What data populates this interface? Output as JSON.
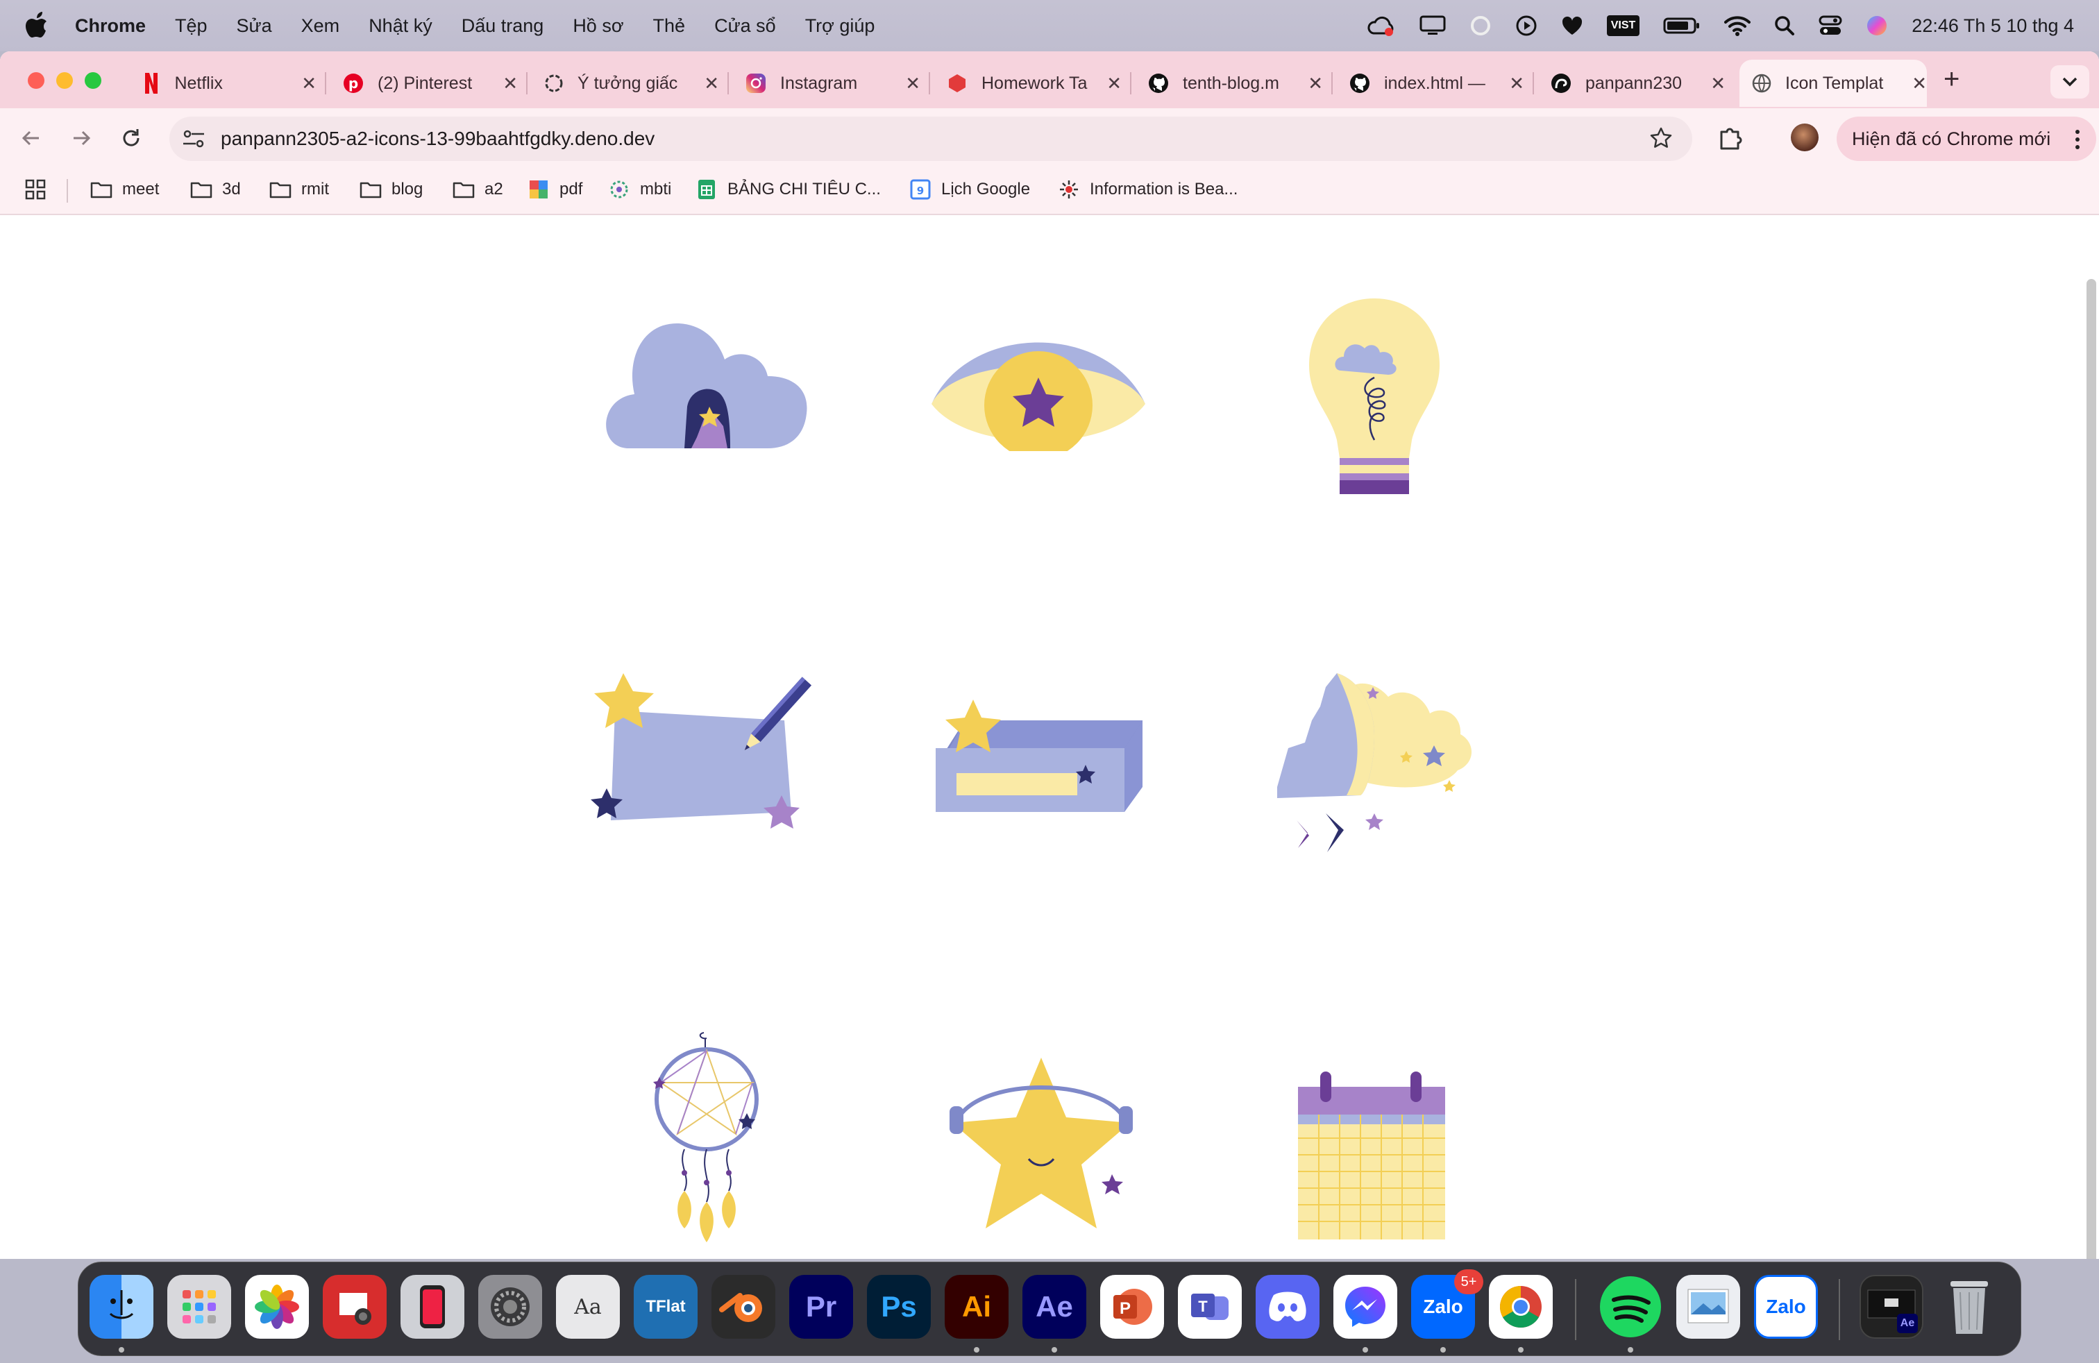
{
  "menubar": {
    "app_name": "Chrome",
    "items": [
      "Tệp",
      "Sửa",
      "Xem",
      "Nhật ký",
      "Dấu trang",
      "Hồ sơ",
      "Thẻ",
      "Cửa sổ",
      "Trợ giúp"
    ],
    "clock": "22:46 Th 5 10 thg 4",
    "vist_badge": "VIST"
  },
  "tabs": [
    {
      "title": "Netflix",
      "icon": "netflix-icon"
    },
    {
      "title": "(2) Pinterest",
      "icon": "pinterest-icon"
    },
    {
      "title": "Ý tưởng giấc",
      "icon": "chatgpt-icon"
    },
    {
      "title": "Instagram",
      "icon": "instagram-icon"
    },
    {
      "title": "Homework Ta",
      "icon": "homework-icon"
    },
    {
      "title": "tenth-blog.m",
      "icon": "github-icon"
    },
    {
      "title": "index.html —",
      "icon": "github-icon"
    },
    {
      "title": "panpann230",
      "icon": "deno-icon"
    },
    {
      "title": "Icon Templat",
      "icon": "globe-icon",
      "active": true
    }
  ],
  "address_bar": {
    "url": "panpann2305-a2-icons-13-99baahtfgdky.deno.dev"
  },
  "update_button": {
    "label": "Hiện đã có Chrome mới"
  },
  "bookmarks": [
    "meet",
    "3d",
    "rmit",
    "blog",
    "a2",
    "pdf",
    "mbti",
    "BẢNG CHI TIÊU C...",
    "Lịch Google",
    "Information is Bea..."
  ],
  "icons": [
    "cloud-star-icon",
    "eye-star-icon",
    "lightbulb-cloud-icon",
    "notepad-pencil-icon",
    "pencil-box-icon",
    "head-dream-icon",
    "dreamcatcher-icon",
    "headphone-star-icon",
    "calendar-icon"
  ],
  "dock": {
    "apps": [
      "Finder",
      "Launchpad",
      "Photos",
      "Photo Booth",
      "iPhone Mirroring",
      "System Settings",
      "Font Book",
      "TFlat Dictionary",
      "Blender",
      "Premiere Pro",
      "Photoshop",
      "Illustrator",
      "After Effects",
      "PowerPoint",
      "Teams",
      "Discord",
      "Messenger",
      "Zalo",
      "Chrome",
      "Spotify",
      "Preview",
      "Zalo",
      "Screen",
      "Trash"
    ],
    "zalo_badge": "5+",
    "pr_label": "Pr",
    "ps_label": "Ps",
    "ai_label": "Ai",
    "ae_label": "Ae",
    "zalo_label": "Zalo",
    "tflat_label": "TFlat"
  },
  "colors": {
    "lavender": "#a9b2df",
    "navy": "#2d2f6b",
    "yellow": "#f3cf55",
    "pale_yellow": "#faeaa6",
    "purple": "#6b3e96",
    "light_purple": "#a783c9"
  }
}
